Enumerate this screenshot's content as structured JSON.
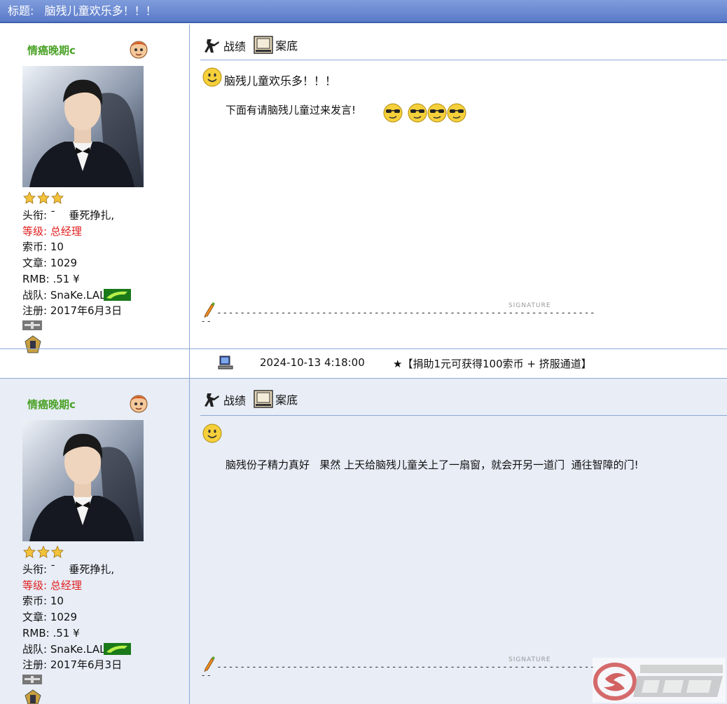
{
  "title_bar": {
    "label": "标题:",
    "text": "脑残儿童欢乐多！！！"
  },
  "posts": [
    {
      "username": "情癌晚期c",
      "rank_stars": 3,
      "profile": {
        "title_label": "头衔:",
        "title_value": "¯    垂死挣扎,",
        "level_label": "等级:",
        "level_value": "总经理",
        "coins_label": "索币:",
        "coins_value": "10",
        "articles_label": "文章:",
        "articles_value": "1029",
        "rmb_label": "RMB:",
        "rmb_value": ".51 ¥",
        "team_label": "战队:",
        "team_value": "SnaKe.LAL",
        "registered_label": "注册:",
        "registered_value": "2017年6月3日"
      },
      "tools": {
        "stats": "战绩",
        "record": "案底"
      },
      "subject": "脑残儿童欢乐多！！！",
      "body": "下面有请脑残儿童过来发言!",
      "signature_word": "SIGNATURE",
      "signature_tail": "- -"
    },
    {
      "username": "情癌晚期c",
      "rank_stars": 3,
      "profile": {
        "title_label": "头衔:",
        "title_value": "¯    垂死挣扎,",
        "level_label": "等级:",
        "level_value": "总经理",
        "coins_label": "索币:",
        "coins_value": "10",
        "articles_label": "文章:",
        "articles_value": "1029",
        "rmb_label": "RMB:",
        "rmb_value": ".51 ¥",
        "team_label": "战队:",
        "team_value": "SnaKe.LAL",
        "registered_label": "注册:",
        "registered_value": "2017年6月3日"
      },
      "tools": {
        "stats": "战绩",
        "record": "案底"
      },
      "subject": "",
      "body": "脑残份子精力真好   果然 上天给脑残儿童关上了一扇窗，就会开另一道门  通往智障的门!",
      "signature_word": "SIGNATURE",
      "signature_tail": "- -"
    }
  ],
  "meta": {
    "timestamp": "2024-10-13 4:18:00",
    "notice": "★【捐助1元可获得100索币 + 挤服通道】"
  },
  "colors": {
    "title_bar": "#6a88d2",
    "border": "#8fa8d6",
    "username": "#4ca228",
    "level": "#e02020",
    "post2_bg": "#e8edf6"
  },
  "icons": [
    "counter-strike-player-icon",
    "film-frame-icon",
    "smiley-icon",
    "sunglasses-emoticon-icon",
    "computer-icon",
    "star-icon",
    "pencil-icon"
  ]
}
